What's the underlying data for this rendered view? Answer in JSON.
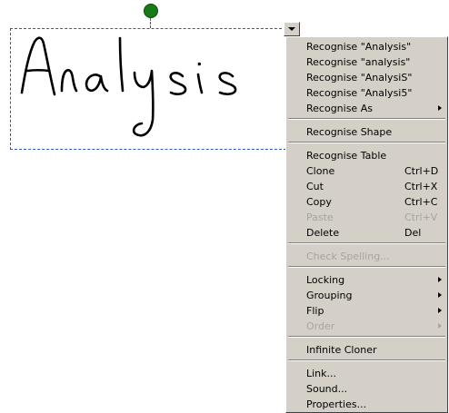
{
  "ink_text": "Analysis",
  "colors": {
    "handle": "#167a16",
    "selection": "#2f54c4",
    "menu_bg": "#d4d0c8",
    "disabled_text": "#a7a49d"
  },
  "menu": {
    "items": [
      {
        "label": "Recognise \"Analysis\""
      },
      {
        "label": "Recognise \"analysis\""
      },
      {
        "label": "Recognise \"AnalysiS\""
      },
      {
        "label": "Recognise \"Analysi5\""
      },
      {
        "label": "Recognise As"
      },
      {
        "label": "Recognise Shape"
      },
      {
        "label": "Recognise Table"
      },
      {
        "label": "Clone",
        "shortcut": "Ctrl+D"
      },
      {
        "label": "Cut",
        "shortcut": "Ctrl+X"
      },
      {
        "label": "Copy",
        "shortcut": "Ctrl+C"
      },
      {
        "label": "Paste",
        "shortcut": "Ctrl+V"
      },
      {
        "label": "Delete",
        "shortcut": "Del"
      },
      {
        "label": "Check Spelling..."
      },
      {
        "label": "Locking"
      },
      {
        "label": "Grouping"
      },
      {
        "label": "Flip"
      },
      {
        "label": "Order"
      },
      {
        "label": "Infinite Cloner"
      },
      {
        "label": "Link..."
      },
      {
        "label": "Sound..."
      },
      {
        "label": "Properties..."
      }
    ]
  }
}
